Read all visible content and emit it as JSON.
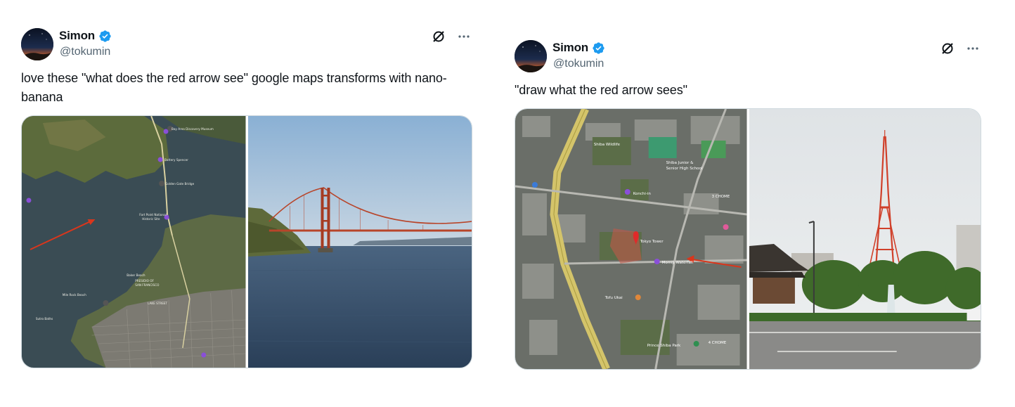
{
  "tweets": [
    {
      "author": {
        "name": "Simon",
        "handle": "@tokumin",
        "verified": true
      },
      "text": "love these \"what does the red arrow see\" google maps transforms with nano-banana",
      "actions": [
        "grok-icon",
        "more-icon"
      ],
      "media": [
        {
          "kind": "satellite-map",
          "labels": [
            "Golden Gate Bridge",
            "Fort Point National Historic Site",
            "Baker Beach",
            "Presidio of San Francisco",
            "Sutro Baths",
            "Lake Street",
            "Mile Rock Beach",
            "Battery Spencer",
            "Bay Area Discovery Museum"
          ]
        },
        {
          "kind": "photo",
          "subject": "Golden Gate Bridge over the bay"
        }
      ]
    },
    {
      "author": {
        "name": "Simon",
        "handle": "@tokumin",
        "verified": true
      },
      "text": "\"draw what the red arrow sees\"",
      "actions": [
        "grok-icon",
        "more-icon"
      ],
      "media": [
        {
          "kind": "satellite-map",
          "labels": [
            "Tokyo Tower",
            "Momiji Waterfall",
            "Shiba Junior & Senior High School",
            "3 CHOME",
            "4 CHOME",
            "Prince Shiba Park",
            "Tofu Ukai",
            "Konchi-in"
          ]
        },
        {
          "kind": "photo",
          "subject": "Tokyo Tower with temple and waterfall"
        }
      ]
    }
  ],
  "colors": {
    "verified": "#1d9bf0",
    "text": "#0f1419",
    "handle": "#536471",
    "border": "#cfd9de",
    "map_arrow": "#d9361c"
  }
}
